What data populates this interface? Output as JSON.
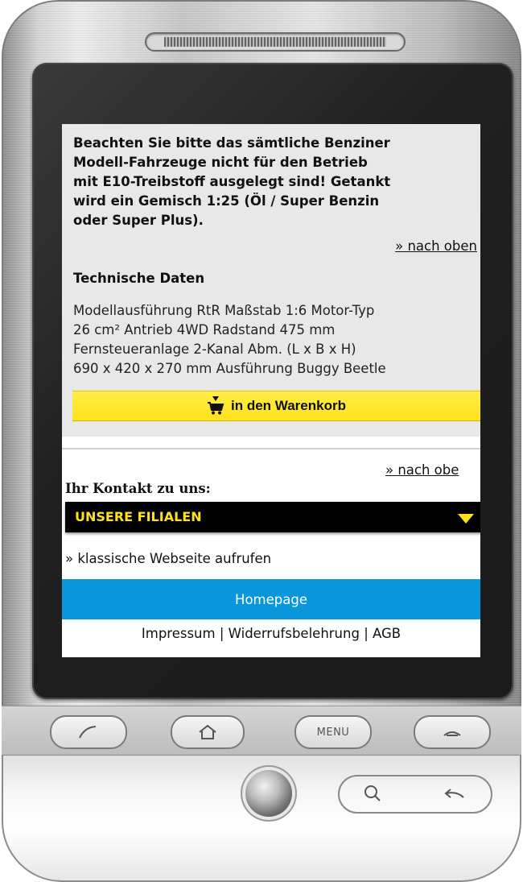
{
  "notice": {
    "line1": "Beachten Sie bitte das sämtliche Benziner",
    "line2": "Modell-Fahrzeuge nicht für den Betrieb",
    "line3": "mit E10-Treibstoff ausgelegt sind! Getankt",
    "line4": "wird ein Gemisch 1:25 (Öl / Super Benzin",
    "line5": "oder Super Plus)."
  },
  "nav": {
    "to_top": "» nach oben",
    "to_top_truncated": "» nach obe"
  },
  "tech": {
    "title": "Technische Daten",
    "line1": "Modellausführung RtR Maßstab 1:6 Motor-Typ",
    "line2": "26 cm² Antrieb 4WD Radstand 475 mm",
    "line3": "Fernsteueranlage 2-Kanal Abm. (L x B x H)",
    "line4": "690 x 420 x 270 mm Ausführung Buggy Beetle"
  },
  "cart": {
    "label": "in den Warenkorb",
    "icon": "shopping-cart-icon"
  },
  "contact": {
    "title": "Ihr Kontakt zu uns:",
    "dropdown_label": "UNSERE FILIALEN"
  },
  "classic_link": "» klassische Webseite aufrufen",
  "homepage_label": "Homepage",
  "footer": {
    "impressum": "Impressum",
    "separator": "|",
    "widerruf": "Widerrufsbelehrung",
    "agb": "AGB"
  },
  "hardware": {
    "menu_label": "MENU"
  },
  "colors": {
    "accent_yellow": "#ffe21a",
    "homepage_blue": "#0a96dc",
    "content_gray": "#e8e8e8"
  }
}
